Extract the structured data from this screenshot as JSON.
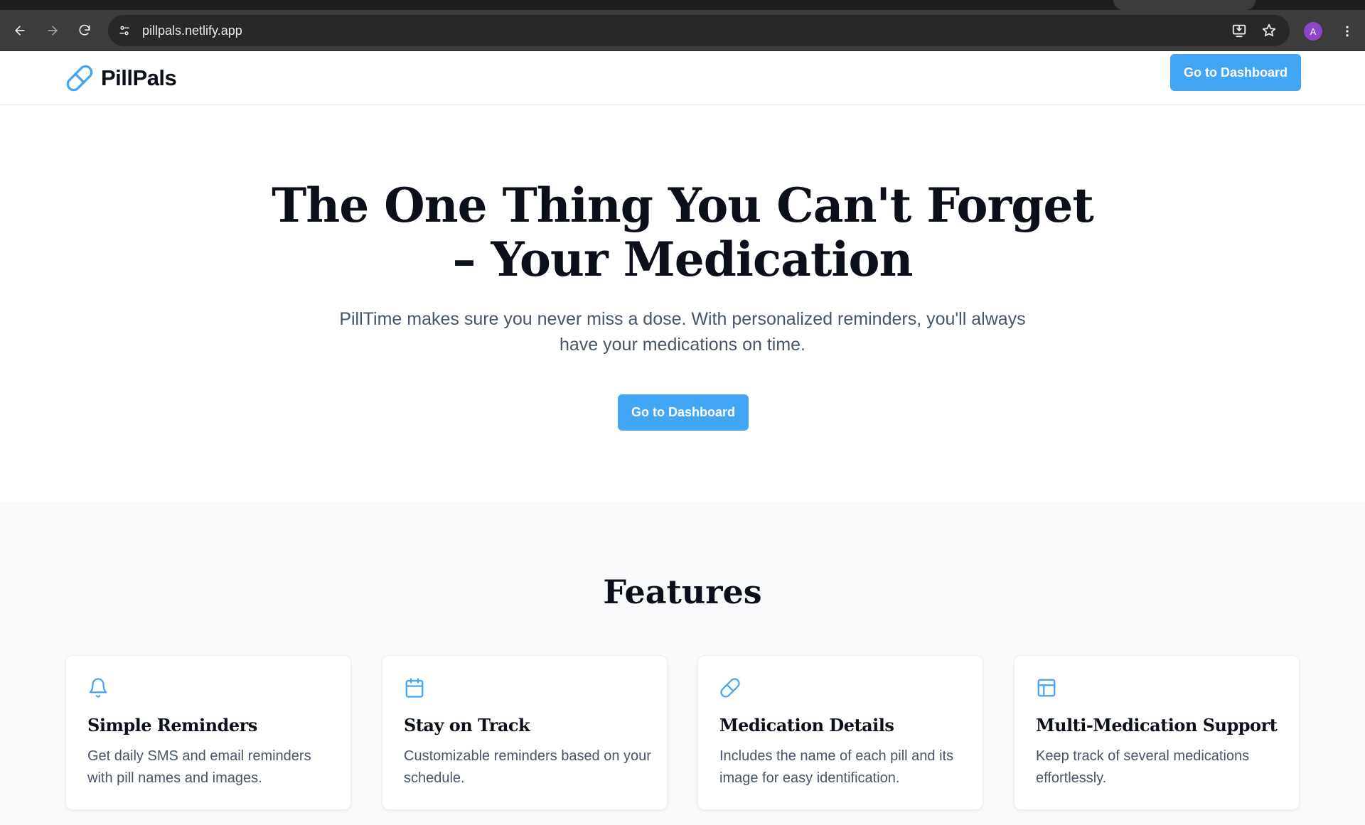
{
  "browser": {
    "url": "pillpals.netlify.app",
    "profile_initial": "A"
  },
  "header": {
    "brand_name": "PillPals",
    "cta_label": "Go to Dashboard"
  },
  "hero": {
    "title": "The One Thing You Can't Forget – Your Medication",
    "subtitle": "PillTime makes sure you never miss a dose. With personalized reminders, you'll always have your medications on time.",
    "cta_label": "Go to Dashboard"
  },
  "features": {
    "title": "Features",
    "items": [
      {
        "icon": "bell-icon",
        "title": "Simple Reminders",
        "text": "Get daily SMS and email reminders with pill names and images."
      },
      {
        "icon": "calendar-icon",
        "title": "Stay on Track",
        "text": "Customizable reminders based on your schedule."
      },
      {
        "icon": "pill-icon",
        "title": "Medication Details",
        "text": "Includes the name of each pill and its image for easy identification."
      },
      {
        "icon": "layout-icon",
        "title": "Multi-Medication Support",
        "text": "Keep track of several medications effortlessly."
      }
    ]
  },
  "colors": {
    "accent": "#42a5f5",
    "heading": "#0b0f19",
    "body_text": "#475569",
    "features_bg": "#f8f9fb",
    "chrome_bg": "#3c3c3c"
  }
}
